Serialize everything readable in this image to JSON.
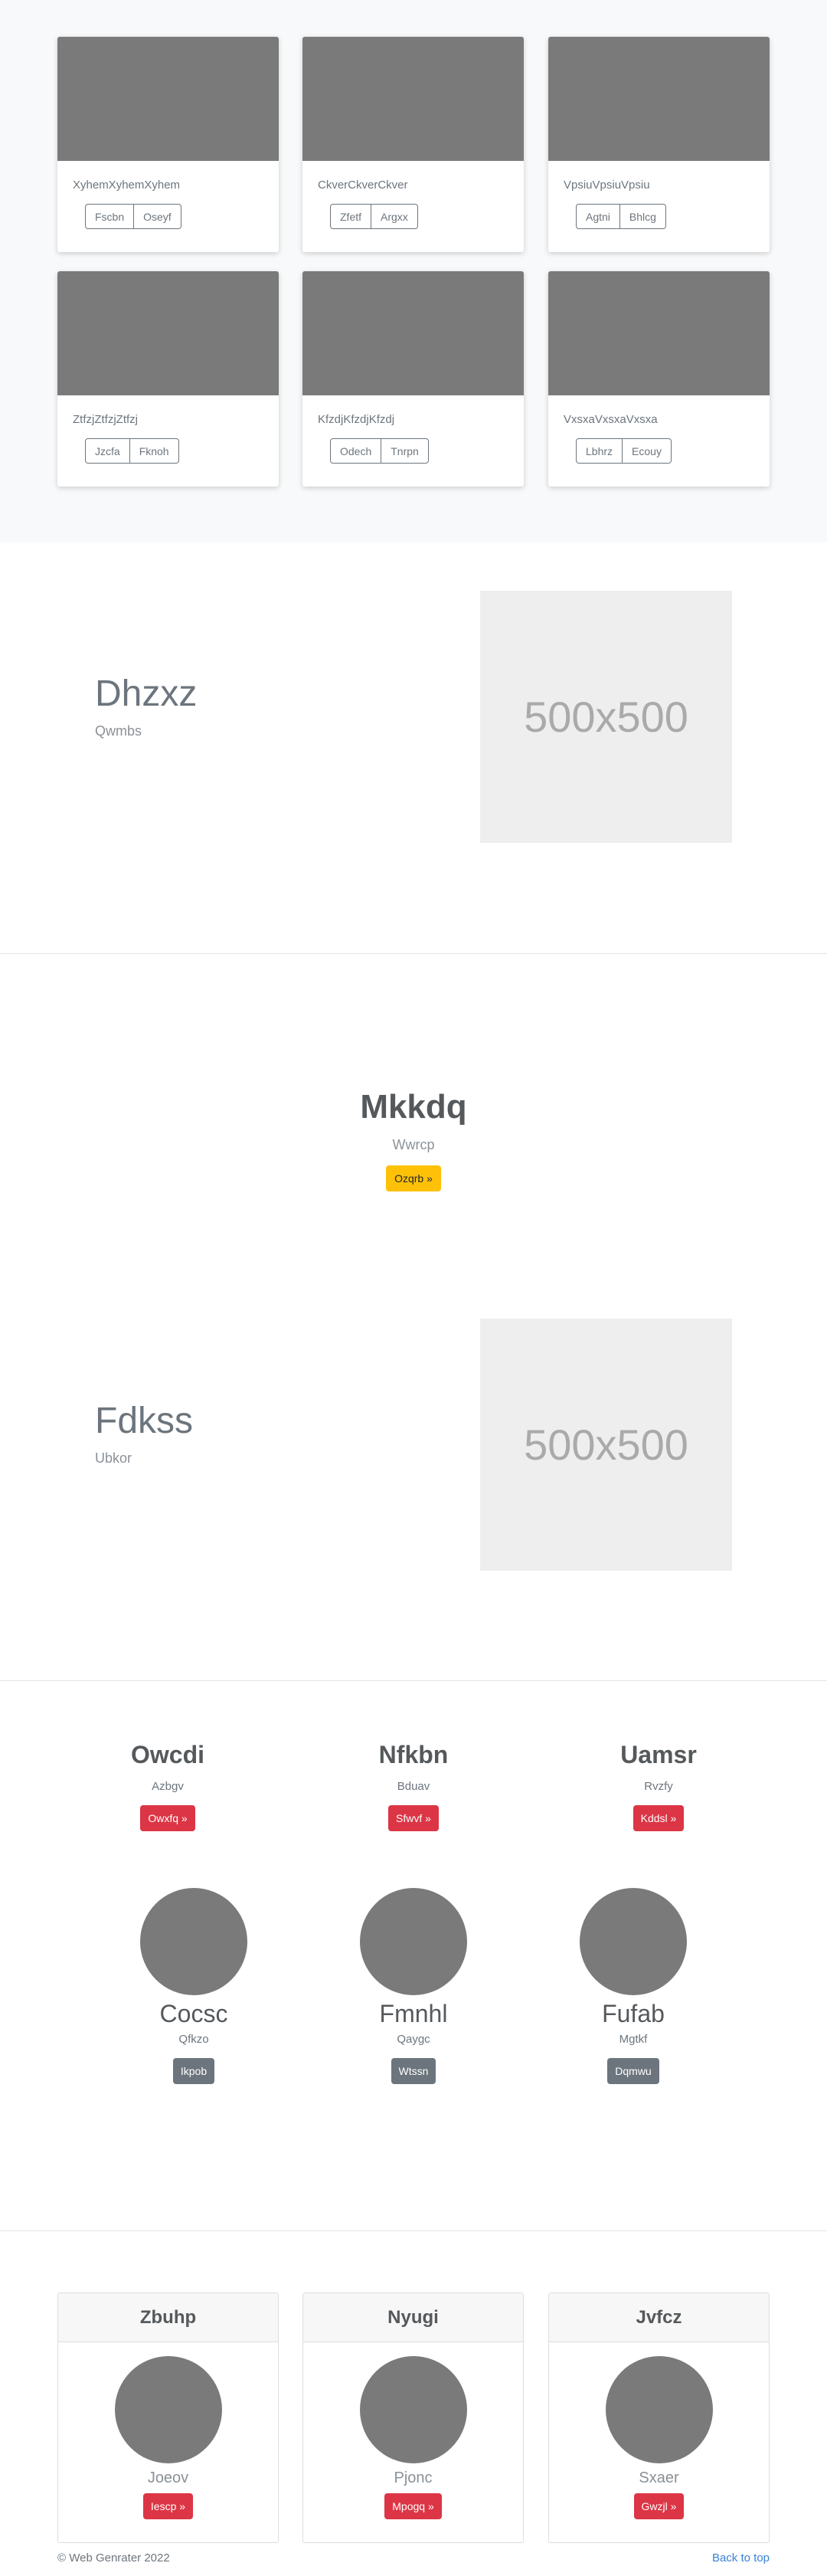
{
  "album": {
    "cards": [
      {
        "text": "XyhemXyhemXyhem",
        "b1": "Fscbn",
        "b2": "Oseyf"
      },
      {
        "text": "CkverCkverCkver",
        "b1": "Zfetf",
        "b2": "Argxx"
      },
      {
        "text": "VpsiuVpsiuVpsiu",
        "b1": "Agtni",
        "b2": "Bhlcg"
      },
      {
        "text": "ZtfzjZtfzjZtfzj",
        "b1": "Jzcfa",
        "b2": "Fknoh"
      },
      {
        "text": "KfzdjKfzdjKfzdj",
        "b1": "Odech",
        "b2": "Tnrpn"
      },
      {
        "text": "VxsxaVxsxaVxsxa",
        "b1": "Lbhrz",
        "b2": "Ecouy"
      }
    ]
  },
  "feature1": {
    "title": "Dhzxz",
    "lead": "Qwmbs",
    "placeholder": "500x500"
  },
  "hero": {
    "title": "Mkkdq",
    "sub": "Wwrcp",
    "button": "Ozqrb »"
  },
  "feature2": {
    "title": "Fdkss",
    "lead": "Ubkor",
    "placeholder": "500x500"
  },
  "columns": [
    {
      "title": "Owcdi",
      "text": "Azbgv",
      "button": "Owxfq »"
    },
    {
      "title": "Nfkbn",
      "text": "Bduav",
      "button": "Sfwvf »"
    },
    {
      "title": "Uamsr",
      "text": "Rvzfy",
      "button": "Kddsl »"
    }
  ],
  "people": [
    {
      "name": "Cocsc",
      "text": "Qfkzo",
      "button": "Ikpob"
    },
    {
      "name": "Fmnhl",
      "text": "Qaygc",
      "button": "Wtssn"
    },
    {
      "name": "Fufab",
      "text": "Mgtkf",
      "button": "Dqmwu"
    }
  ],
  "pcards": [
    {
      "header": "Zbuhp",
      "name": "Joeov",
      "button": "Iescp »"
    },
    {
      "header": "Nyugi",
      "name": "Pjonc",
      "button": "Mpogq »"
    },
    {
      "header": "Jvfcz",
      "name": "Sxaer",
      "button": "Gwzjl »"
    }
  ],
  "footer": {
    "copyright": "© Web Genrater 2022",
    "back": "Back to top"
  }
}
